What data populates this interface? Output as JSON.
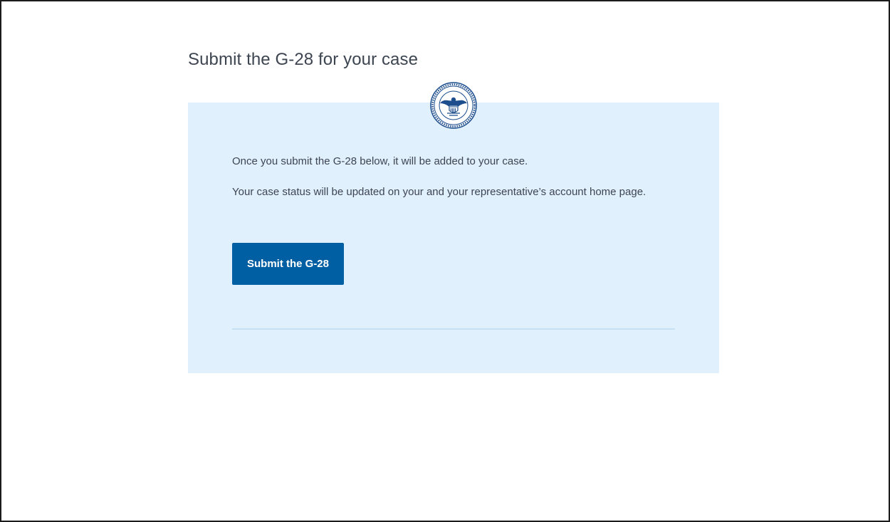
{
  "page": {
    "title": "Submit the G-28 for your case"
  },
  "card": {
    "seal_icon": "dhs-seal-icon",
    "paragraph_1": "Once you submit the G-28 below, it will be added to your case.",
    "paragraph_2": "Your case status will be updated on your and your representative’s account home page.",
    "submit_label": "Submit the G-28"
  },
  "colors": {
    "card_background": "#e1f0fd",
    "button_background": "#005ea2",
    "text": "#3d4551",
    "divider": "#c5e2f5"
  }
}
